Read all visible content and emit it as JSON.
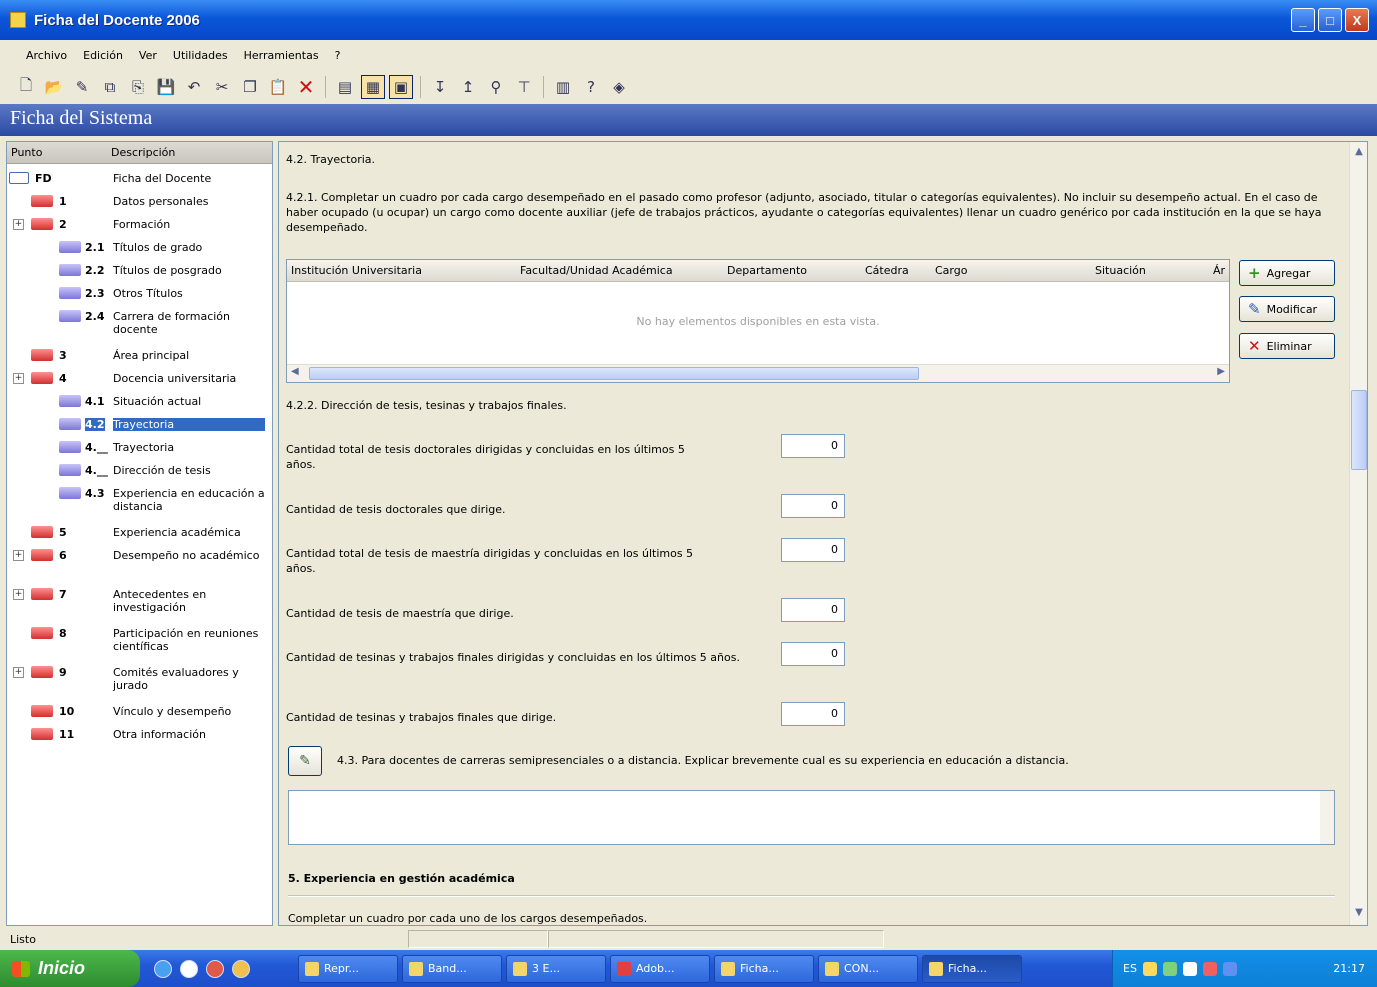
{
  "window": {
    "title": "Ficha del Docente 2006",
    "minimize": "_",
    "maximize": "□",
    "close": "X"
  },
  "menu": [
    "Archivo",
    "Edición",
    "Ver",
    "Utilidades",
    "Herramientas",
    "?"
  ],
  "banner": {
    "title": "Ficha del Sistema"
  },
  "tree": {
    "headers": {
      "punto": "Punto",
      "descripcion": "Descripción"
    },
    "items": [
      {
        "punto": "FD",
        "desc": "Ficha del Docente"
      },
      {
        "punto": "1",
        "desc": "Datos personales"
      },
      {
        "punto": "2",
        "desc": "Formación"
      },
      {
        "punto": "2.1",
        "desc": "Títulos de grado"
      },
      {
        "punto": "2.2",
        "desc": "Títulos de posgrado"
      },
      {
        "punto": "2.3",
        "desc": "Otros Títulos"
      },
      {
        "punto": "2.4",
        "desc": "Carrera de formación docente"
      },
      {
        "punto": "3",
        "desc": "Área principal"
      },
      {
        "punto": "4",
        "desc": "Docencia universitaria"
      },
      {
        "punto": "4.1",
        "desc": "Situación actual"
      },
      {
        "punto": "4.2",
        "desc": "Trayectoria"
      },
      {
        "punto": "4.__",
        "desc": "Trayectoria"
      },
      {
        "punto": "4.__",
        "desc": "Dirección de tesis"
      },
      {
        "punto": "4.3",
        "desc": "Experiencia en educación a distancia"
      },
      {
        "punto": "5",
        "desc": "Experiencia académica"
      },
      {
        "punto": "6",
        "desc": "Desempeño no académico"
      },
      {
        "punto": "7",
        "desc": "Antecedentes en investigación"
      },
      {
        "punto": "8",
        "desc": "Participación en reuniones científicas"
      },
      {
        "punto": "9",
        "desc": "Comités evaluadores y jurado"
      },
      {
        "punto": "10",
        "desc": "Vínculo y desempeño"
      },
      {
        "punto": "11",
        "desc": "Otra información"
      }
    ]
  },
  "main": {
    "section_title": "4.2. Trayectoria.",
    "intro": "4.2.1. Completar un cuadro por cada cargo desempeñado en el pasado como profesor (adjunto, asociado, titular o categorías equivalentes). No incluir su desempeño actual. En el caso de haber ocupado (u ocupar) un cargo como docente auxiliar (jefe de trabajos prácticos, ayudante o categorías equivalentes) llenar un cuadro genérico por cada institución en la que se haya desempeñado.",
    "grid": {
      "columns": [
        "Institución Universitaria",
        "Facultad/Unidad Académica",
        "Departamento",
        "Cátedra",
        "Cargo",
        "Situación",
        "Ár"
      ],
      "empty_text": "No hay elementos disponibles en esta vista."
    },
    "buttons": {
      "add": "Agregar",
      "modify": "Modificar",
      "delete": "Eliminar"
    },
    "tesis_title": "4.2.2. Dirección de tesis, tesinas y trabajos finales.",
    "fields": [
      {
        "label": "Cantidad total de tesis doctorales dirigidas y concluidas en los últimos 5 años.",
        "value": "0"
      },
      {
        "label": "Cantidad de tesis doctorales que dirige.",
        "value": "0"
      },
      {
        "label": "Cantidad total de tesis de maestría dirigidas y concluidas en los últimos 5 años.",
        "value": "0"
      },
      {
        "label": "Cantidad de tesis de maestría que dirige.",
        "value": "0"
      },
      {
        "label": "Cantidad de tesinas y trabajos finales dirigidas y concluidas en los últimos 5 años.",
        "value": "0"
      },
      {
        "label": "Cantidad de tesinas y trabajos finales que dirige.",
        "value": "0"
      }
    ],
    "distance_text": "4.3. Para docentes de carreras semipresenciales o a distancia. Explicar brevemente cual es su experiencia en educación a distancia.",
    "section5_title": "5. Experiencia en gestión académica",
    "section5_text": "Completar un cuadro por cada uno de los cargos desempeñados."
  },
  "status": {
    "text": "Listo"
  },
  "taskbar": {
    "start": "Inicio",
    "tasks": [
      "Repr...",
      "Band...",
      "3 E...",
      "Adob...",
      "Ficha...",
      "CON...",
      "Ficha..."
    ],
    "tray_lang": "ES",
    "clock": "21:17"
  }
}
